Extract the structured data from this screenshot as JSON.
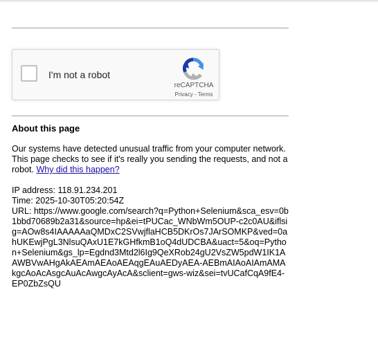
{
  "captcha": {
    "checkbox_label": "I'm not a robot",
    "brand": "reCAPTCHA",
    "privacy": "Privacy",
    "separator": " - ",
    "terms": "Terms",
    "logo_icon": "recaptcha-logo-icon",
    "colors": {
      "blue": "#1c3aa9",
      "light_blue": "#4a90e2",
      "grey": "#b1b1b1"
    }
  },
  "about": {
    "title": "About this page",
    "message": "Our systems have detected unusual traffic from your computer network. This page checks to see if it's really you sending the requests, and not a robot.",
    "link": "Why did this happen?"
  },
  "details": {
    "ip": "IP address: 118.91.234.201",
    "time": "Time: 2025-10-30T05:20:54Z",
    "url": "URL: https://www.google.com/search?q=Python+Selenium&sca_esv=0b1bbd70689b2a31&source=hp&ei=tPUCac_WNbWm5OUP-c2c0AU&iflsig=AOw8s4IAAAAAaQMDxC2SVwjflaHCB5DKrOs7JArSOMKP&ved=0ahUKEwjPgL3NlsuQAxU1E7kGHfkmB1oQ4dUDCBA&uact=5&oq=Python+Selenium&gs_lp=Egdnd3Mtd2l6Ig9QeXRob24gU2VsZW5pdW1IK1AAWBVwAHgAkAEAmAEAoAEAqgEAuAEDyAEA-AEBmAIAoAIAmAMAkgcAoAcAsgcAuAcAwgcAyAcA&sclient=gws-wiz&sei=tvUCafCqA9fE4-EP0ZbZsQU"
  }
}
